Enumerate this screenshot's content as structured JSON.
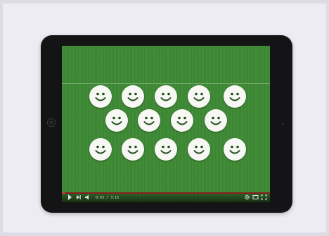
{
  "video": {
    "time": "0:03 / 3:15",
    "progress_percent": 1.5
  },
  "icons": {
    "home": "home-button-icon",
    "play": "play-icon",
    "next": "next-icon",
    "volume": "volume-icon",
    "settings": "gear-icon",
    "theater": "theater-mode-icon",
    "fullscreen": "fullscreen-icon",
    "smiley": "smiley-face-icon"
  },
  "colors": {
    "field": "#3e8a35",
    "smiley": "#f7f7f3",
    "progress": "#8a1c1c",
    "bezel": "#141416"
  }
}
